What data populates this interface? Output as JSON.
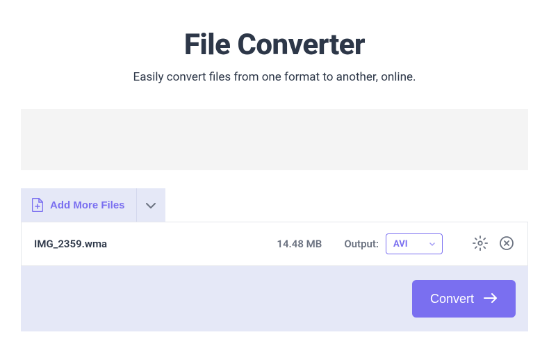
{
  "header": {
    "title": "File Converter",
    "subtitle": "Easily convert files from one format to another, online."
  },
  "toolbar": {
    "add_more_label": "Add More Files"
  },
  "file": {
    "name": "IMG_2359.wma",
    "size": "14.48 MB",
    "output_label": "Output:",
    "selected_format": "AVI"
  },
  "footer": {
    "convert_label": "Convert"
  }
}
